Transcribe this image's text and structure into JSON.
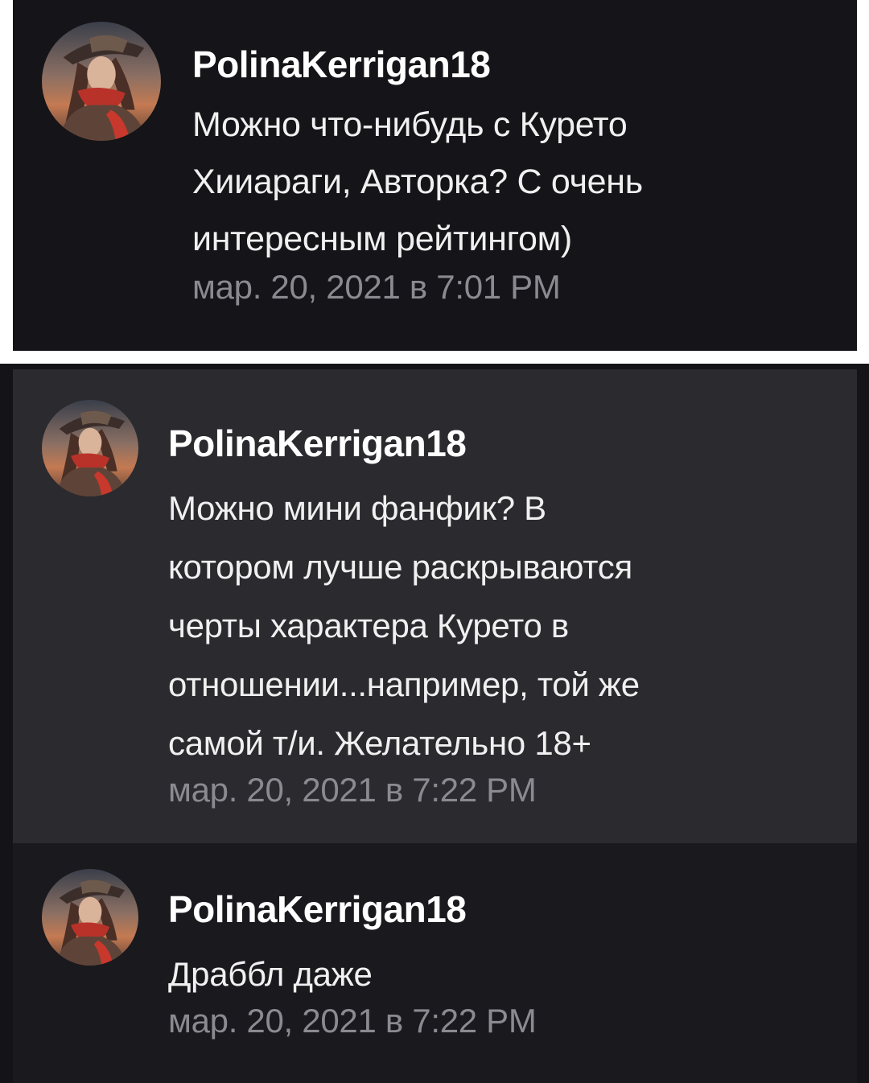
{
  "comments": [
    {
      "username": "PolinaKerrigan18",
      "message_lines": [
        "Можно что-нибудь с Курето",
        "Хииараги, Авторка? С очень",
        "интересным рейтингом)"
      ],
      "timestamp": "мар. 20, 2021 в 7:01 PM"
    },
    {
      "username": "PolinaKerrigan18",
      "message_lines": [
        "Можно мини фанфик? В",
        "котором лучше раскрываются",
        "черты характера Курето в",
        "отношении...например, той же",
        "самой т/и. Желательно 18+"
      ],
      "timestamp": "мар. 20, 2021 в 7:22 PM"
    },
    {
      "username": "PolinaKerrigan18",
      "message_lines": [
        "Драббл даже"
      ],
      "timestamp": "мар. 20, 2021 в 7:22 PM"
    }
  ],
  "avatar_icon": "user-avatar-icon",
  "colors": {
    "page_background": "#000000",
    "frame_white": "#ffffff",
    "card_dark": "#151418",
    "card_highlight": "#2b2a2f",
    "text_primary": "#f0f0f0",
    "text_timestamp": "#8b8a90"
  }
}
